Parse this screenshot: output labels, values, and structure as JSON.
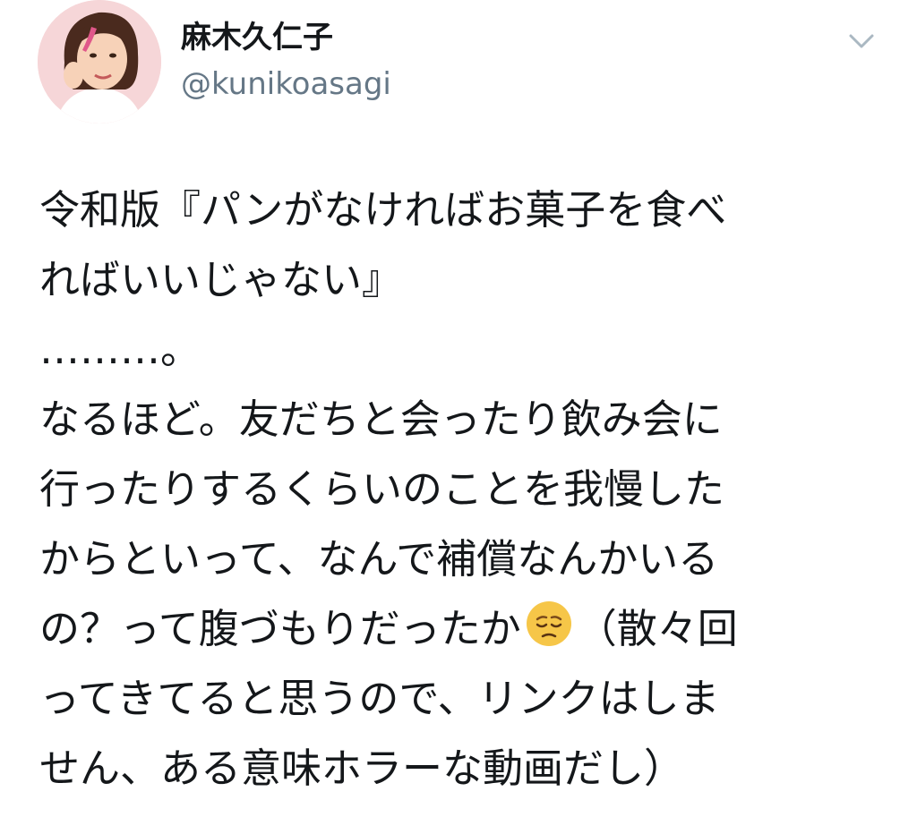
{
  "author": {
    "display_name": "麻木久仁子",
    "handle": "@kunikoasagi",
    "avatar_icon": "profile-avatar"
  },
  "menu": {
    "icon": "chevron-down-icon"
  },
  "tweet": {
    "lines": [
      "令和版『パンがなければお菓子を食べ",
      "ればいいじゃない』",
      "………。",
      "なるほど。友だちと会ったり飲み会に",
      "行ったりするくらいのことを我慢した",
      "からといって、なんで補償なんかいる",
      "の？って腹づもりだったか",
      "（散々回",
      "ってきてると思うので、リンクはしま",
      "せん、ある意味ホラーな動画だし）"
    ],
    "emoji_icon": "pensive-face-emoji"
  },
  "colors": {
    "text": "#14171a",
    "secondary": "#657786",
    "chevron": "#aab8c2",
    "emoji": "#f6c648"
  }
}
